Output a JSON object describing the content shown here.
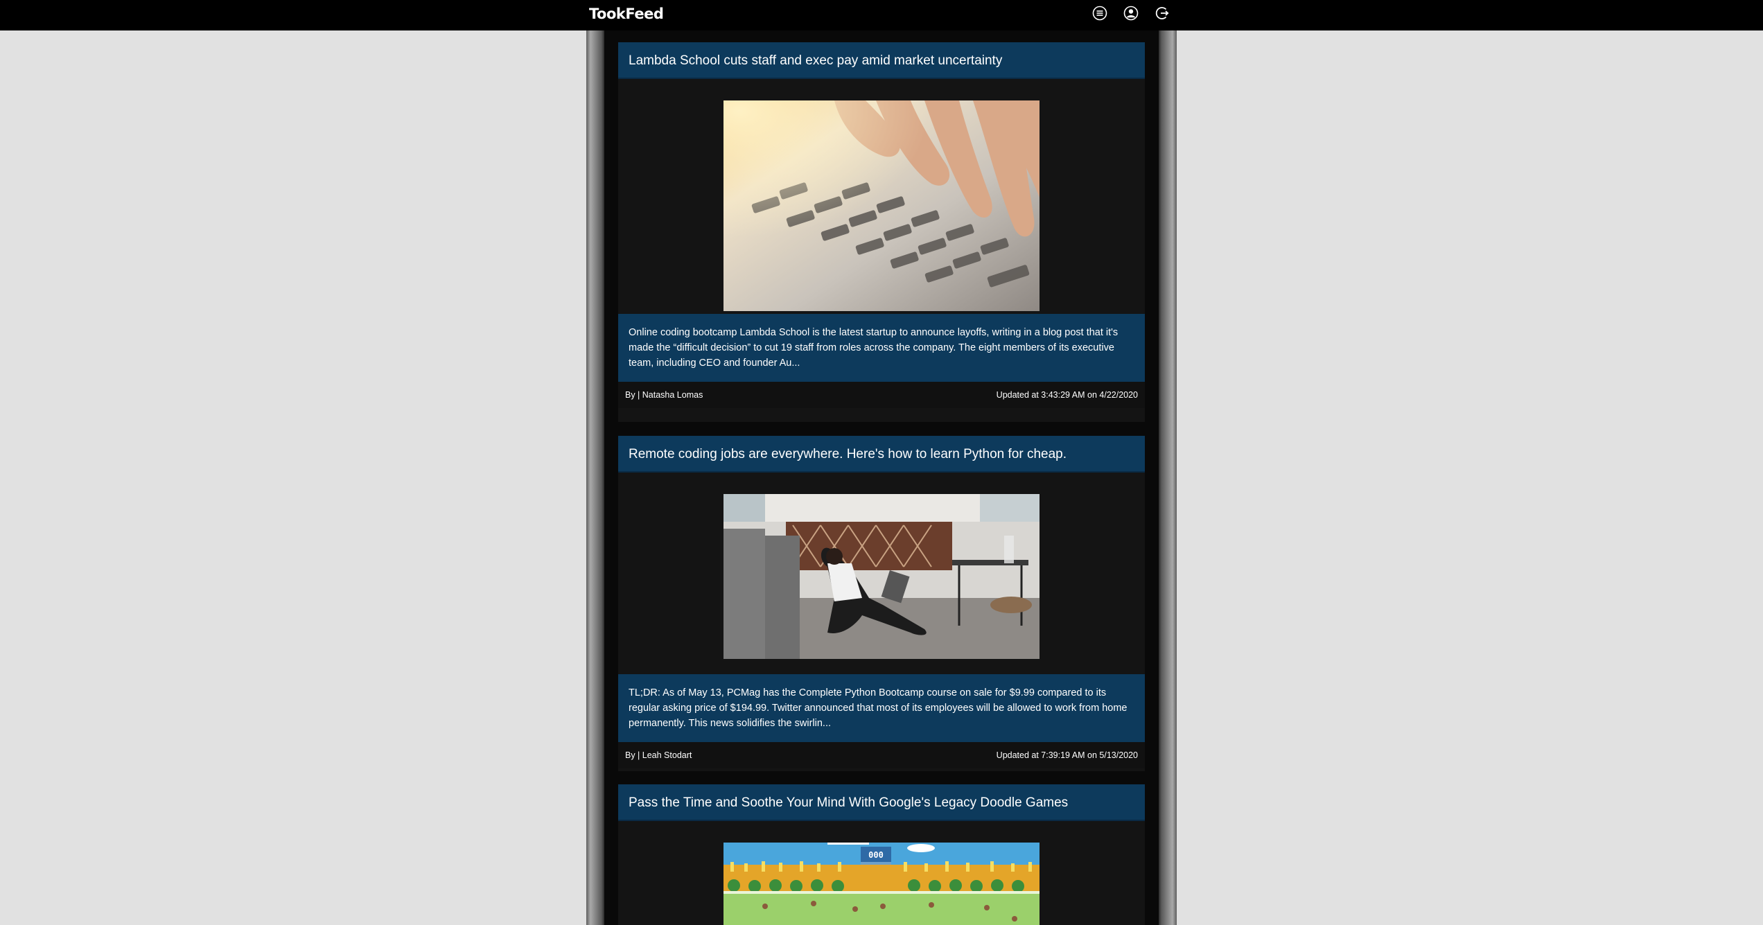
{
  "app": {
    "brand": "TookFeed",
    "nav_icons": [
      "menu-icon",
      "user-icon",
      "logout-icon"
    ]
  },
  "colors": {
    "page_bg": "#e1e1e1",
    "navbar_bg": "#000000",
    "card_header_bg": "#0d3a5c",
    "card_bg": "#141414",
    "text": "#ffffff"
  },
  "articles": [
    {
      "title": "Lambda School cuts staff and exec pay amid market uncertainty",
      "image": "hands-typing-on-laptop-keyboard",
      "description": "Online coding bootcamp Lambda School is the latest startup to announce layoffs, writing in a blog post that it's made the “difficult decision” to cut 19 staff from roles across the company. The eight members of its executive team, including CEO and founder Au...",
      "author": "By | Natasha Lomas",
      "updated": "Updated at 3:43:29 AM on 4/22/2020"
    },
    {
      "title": "Remote coding jobs are everywhere. Here's how to learn Python for cheap.",
      "image": "woman-with-laptop-sitting-on-floor",
      "description": "TL;DR: As of May 13, PCMag has the Complete Python Bootcamp course on sale for $9.99 compared to its regular asking price of $194.99. Twitter announced that most of its employees will be allowed to work from home permanently. This news solidifies the swirlin...",
      "author": "By | Leah Stodart",
      "updated": "Updated at 7:39:19 AM on 5/13/2020"
    },
    {
      "title": "Pass the Time and Soothe Your Mind With Google's Legacy Doodle Games",
      "image": "doodle-game-stadium-scene",
      "scoreboard": "000"
    }
  ]
}
